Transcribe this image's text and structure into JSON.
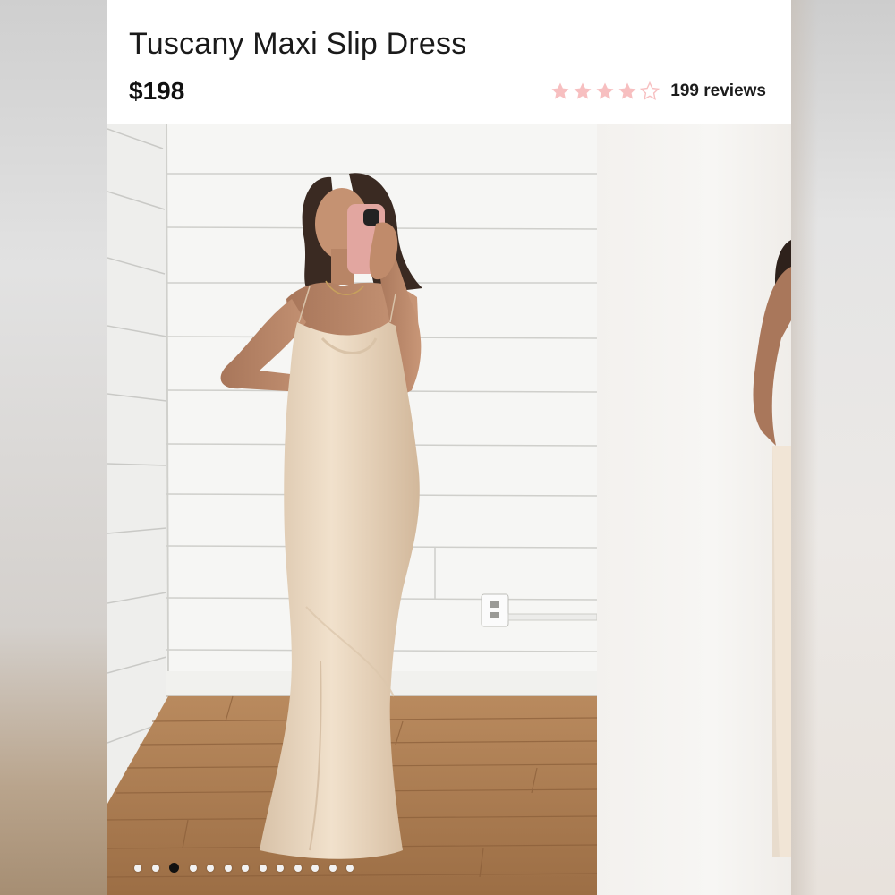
{
  "product": {
    "title": "Tuscany Maxi Slip Dress",
    "price": "$198",
    "rating": 4,
    "rating_max": 5,
    "reviews_label": "199 reviews"
  },
  "gallery": {
    "dot_count": 13,
    "active_index": 2
  },
  "colors": {
    "star_filled": "#f7bfc0",
    "star_empty": "#f7bfc0",
    "dot_active": "#111111",
    "dot_inactive": "#f2f2f2"
  },
  "icons": {
    "star": "star-icon",
    "star_empty": "star-outline-icon"
  }
}
